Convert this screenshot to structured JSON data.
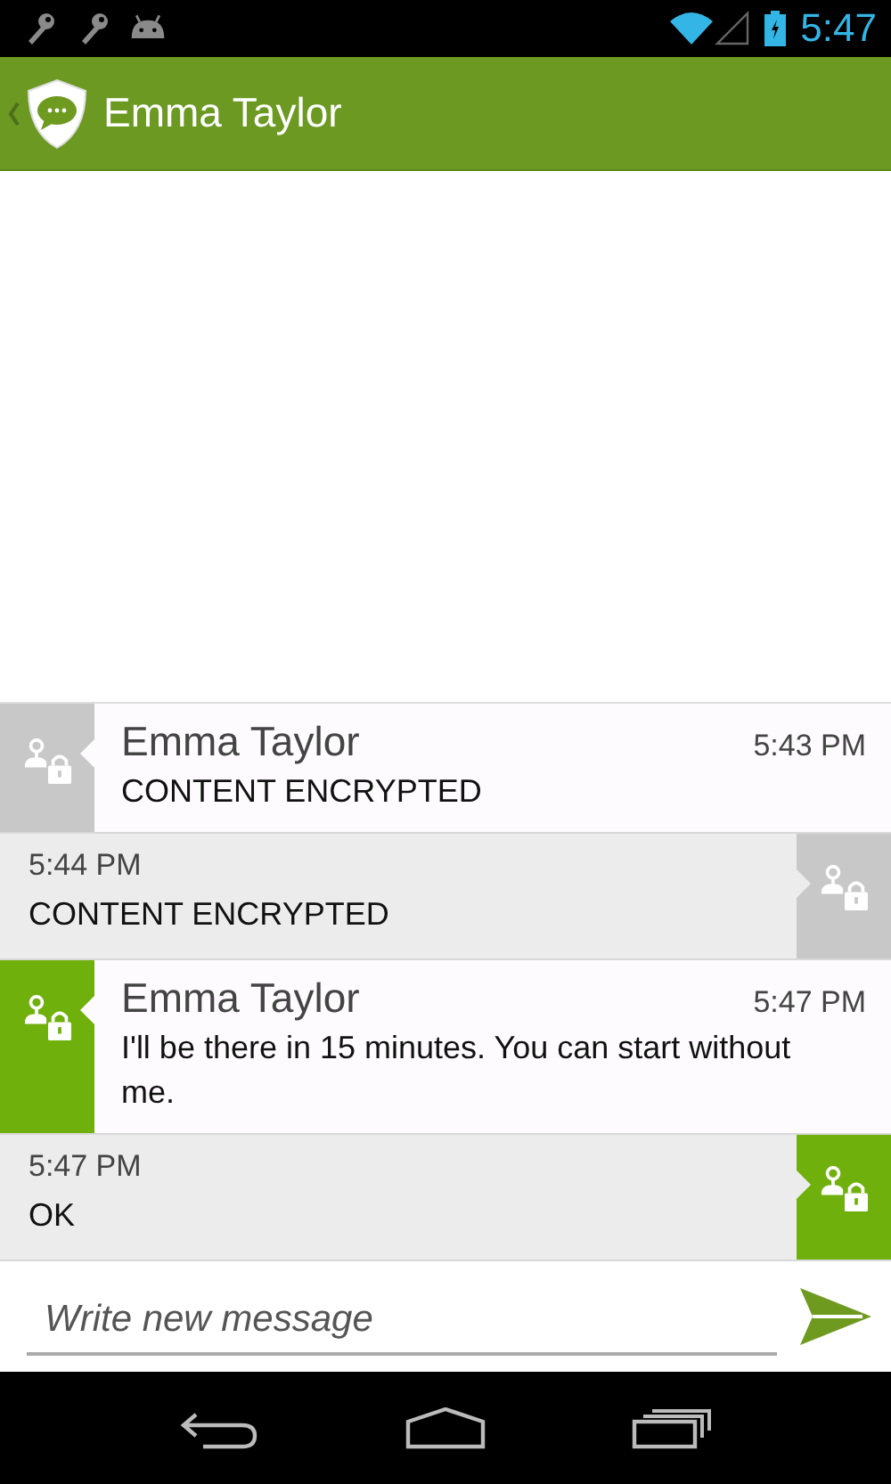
{
  "status_bar": {
    "time": "5:47"
  },
  "action_bar": {
    "title": "Emma Taylor"
  },
  "messages": [
    {
      "kind": "incoming",
      "sender": "Emma Taylor",
      "time": "5:43 PM",
      "text": "CONTENT ENCRYPTED",
      "decrypted": false
    },
    {
      "kind": "outgoing",
      "time": "5:44 PM",
      "text": "CONTENT ENCRYPTED",
      "decrypted": false
    },
    {
      "kind": "incoming",
      "sender": "Emma Taylor",
      "time": "5:47 PM",
      "text": "I'll be there in 15 minutes. You can start without me.",
      "decrypted": true
    },
    {
      "kind": "outgoing",
      "time": "5:47 PM",
      "text": "OK",
      "decrypted": true
    }
  ],
  "composer": {
    "placeholder": "Write new message"
  }
}
